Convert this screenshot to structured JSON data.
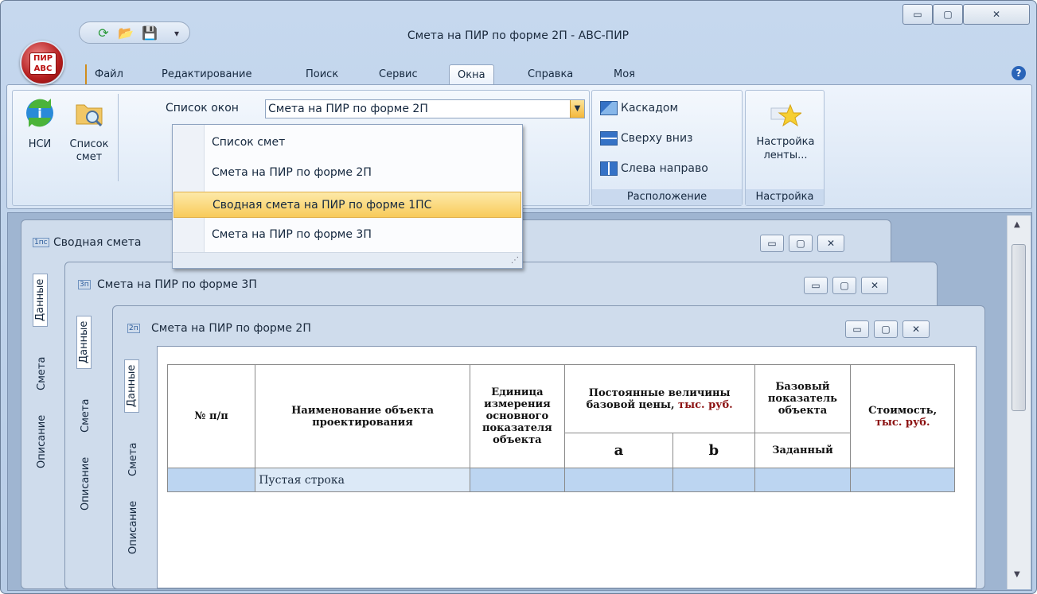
{
  "window": {
    "title": "Смета на ПИР по форме 2П - АВС-ПИР",
    "logo_text": "ПИР АВС",
    "controls": {
      "minimize": "▭",
      "maximize": "▢",
      "close": "✕"
    }
  },
  "ribbon_tabs": [
    {
      "label": "Файл",
      "active": false
    },
    {
      "label": "Редактирование",
      "active": false
    },
    {
      "label": "Поиск",
      "active": false
    },
    {
      "label": "Сервис",
      "active": false
    },
    {
      "label": "Окна",
      "active": true
    },
    {
      "label": "Справка",
      "active": false
    },
    {
      "label": "Моя",
      "active": false
    }
  ],
  "help_icon": "?",
  "ribbon": {
    "nsi_label": "НСИ",
    "spisok_smet_line1": "Список",
    "spisok_smet_line2": "смет",
    "window_list_label": "Список окон",
    "window_list_value": "Смета на ПИР по форме 2П",
    "cascade_label": "Каскадом",
    "top_down_label": "Сверху вниз",
    "left_right_label": "Слева направо",
    "arrangement_group": "Расположение",
    "ribbon_settings_line1": "Настройка",
    "ribbon_settings_line2": "ленты...",
    "settings_group": "Настройка"
  },
  "dropdown_items": [
    {
      "label": "Список смет",
      "highlighted": false
    },
    {
      "label": "Смета на ПИР по форме 2П",
      "highlighted": false
    },
    {
      "label": "Сводная смета на ПИР по форме 1ПС",
      "highlighted": true
    },
    {
      "label": "Смета на ПИР по форме 3П",
      "highlighted": false
    }
  ],
  "child_windows": {
    "w1": {
      "icon": "1пс",
      "title": "Сводная смета"
    },
    "w2": {
      "icon": "3п",
      "title": "Смета на ПИР по форме 3П"
    },
    "w3": {
      "icon": "2п",
      "title": "Смета на ПИР по форме 2П"
    }
  },
  "vertical_tabs": {
    "data": "Данные",
    "smeta": "Смета",
    "opisanie": "Описание"
  },
  "table": {
    "col_num": "№ п/п",
    "col_name": "Наименование объекта проектирования",
    "col_unit": "Единица измерения основного показателя объекта",
    "col_const_main": "Постоянные величины базовой цены,",
    "col_const_unit": "тыс. руб.",
    "col_a": "a",
    "col_b": "b",
    "col_base": "Базовый показатель объекта",
    "col_base_sub": "Заданный",
    "col_cost": "Стоимость,",
    "col_cost_unit": "тыс. руб.",
    "row1_name": "Пустая строка"
  },
  "colors": {
    "highlight": "#f8cb5a",
    "row_selected": "#bcd5f1",
    "accent_red": "#8b1010"
  }
}
